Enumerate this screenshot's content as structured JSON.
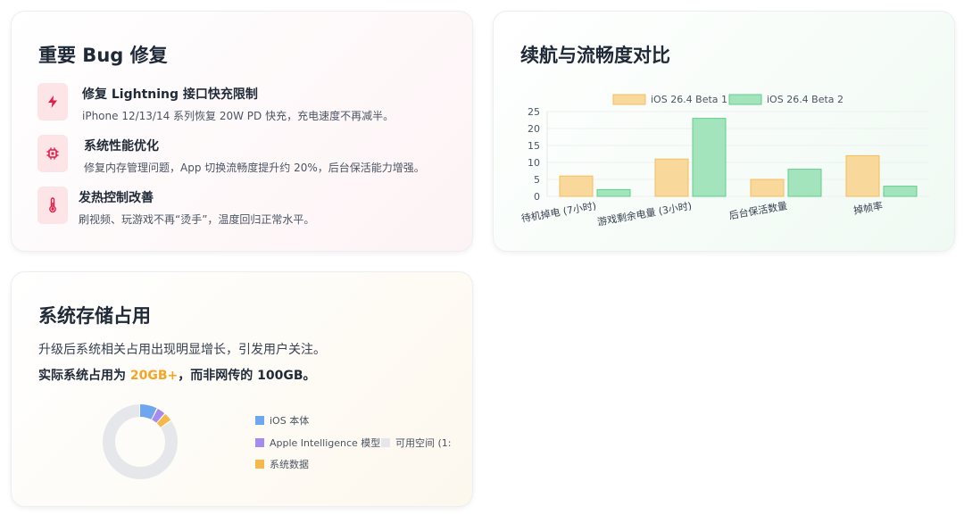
{
  "bug_card": {
    "title": "重要 Bug 修复",
    "items": [
      {
        "icon": "lightning-icon",
        "title": "修复 Lightning 接口快充限制",
        "desc": "iPhone 12/13/14 系列恢复 20W PD 快充，充电速度不再减半。"
      },
      {
        "icon": "chip-icon",
        "title": "系统性能优化",
        "desc": "修复内存管理问题，App 切换流畅度提升约 20%，后台保活能力增强。"
      },
      {
        "icon": "thermometer-icon",
        "title": "发热控制改善",
        "desc": "刷视频、玩游戏不再“烫手”，温度回归正常水平。"
      }
    ],
    "icon_bg": "#fde4e7",
    "icon_color": "#e11d48"
  },
  "battery_card": {
    "title": "续航与流畅度对比"
  },
  "chart_data": {
    "type": "bar",
    "categories": [
      "待机掉电 (7小时)",
      "游戏剩余电量 (3小时)",
      "后台保活数量",
      "掉帧率"
    ],
    "series": [
      {
        "name": "iOS 26.4 Beta 1",
        "values": [
          6,
          11,
          5,
          12
        ],
        "color": "#f9d89b",
        "border": "#f4be5f"
      },
      {
        "name": "iOS 26.4 Beta 2",
        "values": [
          2,
          23,
          8,
          3
        ],
        "color": "#a3e4bd",
        "border": "#5fcf8e"
      }
    ],
    "yticks": [
      0,
      5,
      10,
      15,
      20,
      25
    ],
    "ylim": [
      0,
      25
    ],
    "legend": "top"
  },
  "storage_card": {
    "title": "系统存储占用",
    "line1": "升级后系统相关占用出现明显增长，引发用户关注。",
    "line2_prefix": "实际系统占用为 ",
    "line2_highlight": "20GB+",
    "line2_suffix": "，而非网传的 100GB。",
    "highlight_color": "#f5a524",
    "legend": [
      {
        "label": "iOS 本体",
        "color": "#6ea6f0"
      },
      {
        "label": "Apple Intelligence 模型",
        "color": "#a48bf0"
      },
      {
        "label": "系统数据",
        "color": "#f6b74b"
      },
      {
        "label": "可用空间 (1:",
        "color": "#e5e7eb"
      }
    ],
    "donut": {
      "segments": [
        {
          "value": 10,
          "color": "#6ea6f0"
        },
        {
          "value": 5,
          "color": "#a48bf0"
        },
        {
          "value": 5,
          "color": "#f6b74b"
        },
        {
          "value": 108,
          "color": "#e5e7eb"
        }
      ]
    }
  }
}
